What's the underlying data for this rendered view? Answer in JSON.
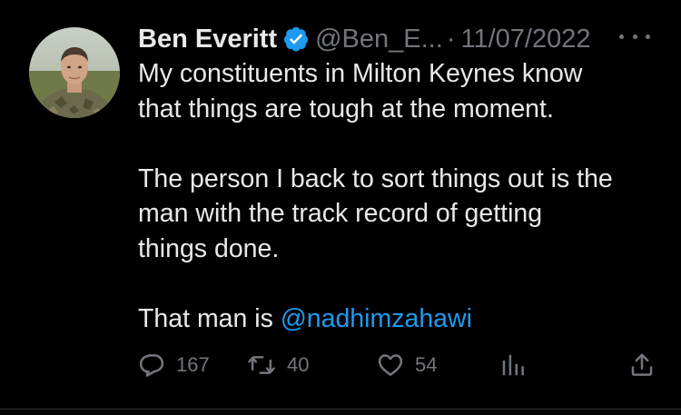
{
  "tweet": {
    "author_name": "Ben Everitt",
    "handle": "@Ben_E...",
    "separator": "·",
    "date": "11/07/2022",
    "body_paragraphs": [
      [
        "My constituents in Milton Keynes know",
        "that things are tough at the moment."
      ],
      [
        "The person I back to sort things out is the",
        "man with the track record of getting",
        "things done."
      ]
    ],
    "closing_prefix": "That man is ",
    "closing_mention": "@nadhimzahawi",
    "verified": true,
    "icons": {
      "verified": "verified-badge-icon",
      "more": "more-options-icon",
      "reply": "reply-icon",
      "retweet": "retweet-icon",
      "like": "like-icon",
      "analytics": "analytics-icon",
      "share": "share-icon"
    },
    "stats": {
      "replies": "167",
      "retweets": "40",
      "likes": "54"
    },
    "colors": {
      "background": "#000000",
      "text": "#e7e9ea",
      "secondary": "#71767b",
      "accent": "#1d9bf0"
    }
  }
}
